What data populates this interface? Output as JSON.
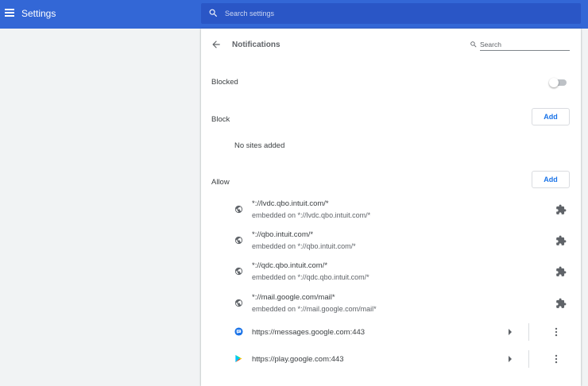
{
  "header": {
    "title": "Settings",
    "search_placeholder": "Search settings"
  },
  "page": {
    "title": "Notifications",
    "search_placeholder": "Search"
  },
  "blocked": {
    "label": "Blocked",
    "enabled": false
  },
  "block_section": {
    "title": "Block",
    "add_label": "Add",
    "empty_text": "No sites added"
  },
  "allow_section": {
    "title": "Allow",
    "add_label": "Add",
    "sites": [
      {
        "url": "*://lvdc.qbo.intuit.com/*",
        "embedded": "embedded on *://lvdc.qbo.intuit.com/*",
        "icon": "globe-icon",
        "action": "extension-icon"
      },
      {
        "url": "*://qbo.intuit.com/*",
        "embedded": "embedded on *://qbo.intuit.com/*",
        "icon": "globe-icon",
        "action": "extension-icon"
      },
      {
        "url": "*://qdc.qbo.intuit.com/*",
        "embedded": "embedded on *://qdc.qbo.intuit.com/*",
        "icon": "globe-icon",
        "action": "extension-icon"
      },
      {
        "url": "*://mail.google.com/mail*",
        "embedded": "embedded on *://mail.google.com/mail*",
        "icon": "globe-icon",
        "action": "extension-icon"
      },
      {
        "url": "https://messages.google.com:443",
        "icon": "messages-icon",
        "action": "more-menu"
      },
      {
        "url": "https://play.google.com:443",
        "icon": "google-play-icon",
        "action": "more-menu"
      }
    ]
  },
  "colors": {
    "header": "#3367d6",
    "search_bg": "#2a56c6",
    "accent": "#1a73e8",
    "page_bg": "#f1f3f4"
  }
}
